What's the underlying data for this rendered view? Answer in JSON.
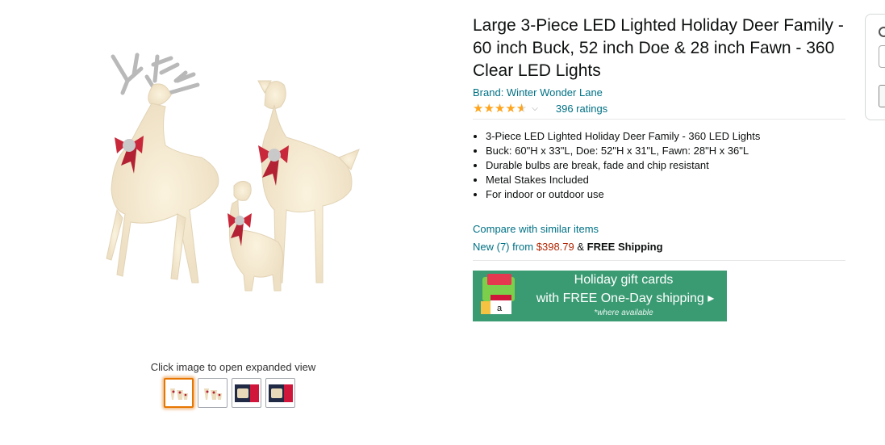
{
  "image_block": {
    "hint": "Click image to open expanded view",
    "thumbnails": [
      {
        "icon": "deer-family-thumbnail",
        "selected": true
      },
      {
        "icon": "deer-family-thumbnail",
        "selected": false
      },
      {
        "icon": "product-box-thumbnail",
        "selected": false
      },
      {
        "icon": "product-box-thumbnail",
        "selected": false
      }
    ]
  },
  "product": {
    "title": "Large 3-Piece LED Lighted Holiday Deer Family - 60 inch Buck, 52 inch Doe & 28 inch Fawn - 360 Clear LED Lights",
    "brand": "Brand: Winter Wonder Lane",
    "rating": 4.6,
    "ratings_count": "396 ratings",
    "bullets": [
      "3-Piece LED Lighted Holiday Deer Family - 360 LED Lights",
      "Buck: 60\"H x 33\"L, Doe: 52\"H x 31\"L, Fawn: 28\"H x 36\"L",
      "Durable bulbs are break, fade and chip resistant",
      "Metal Stakes Included",
      "For indoor or outdoor use"
    ],
    "compare": "Compare with similar items",
    "offer": {
      "new_label": "New (7) from",
      "price": "$398.79",
      "amp": "&",
      "shipping": "FREE Shipping"
    }
  },
  "banner": {
    "line1": "Holiday gift cards",
    "line2": "with FREE One-Day shipping ▸",
    "note": "*where available"
  },
  "colors": {
    "link": "#007185",
    "price": "#B12704",
    "star": "#FFA41C",
    "banner_bg": "#3a9b73",
    "selected_thumb": "#e77600"
  }
}
